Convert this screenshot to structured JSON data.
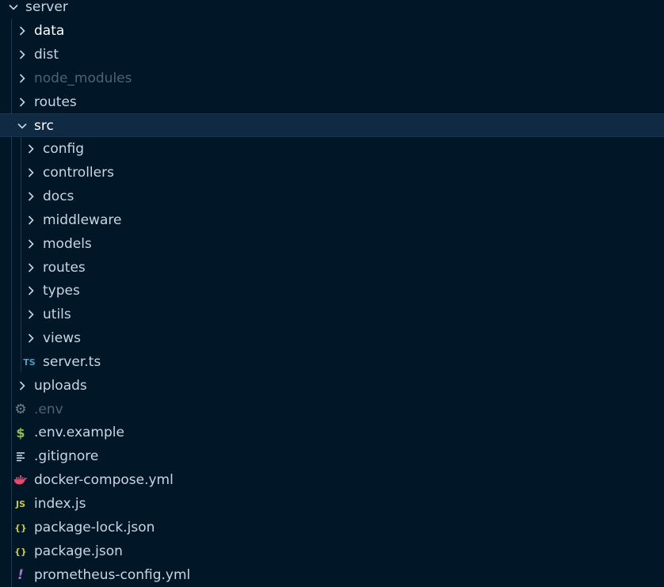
{
  "explorer": {
    "root": {
      "label": "server"
    },
    "items": [
      {
        "label": "data",
        "kind": "folder",
        "expanded": false,
        "depth": 0
      },
      {
        "label": "dist",
        "kind": "folder",
        "expanded": false,
        "depth": 0
      },
      {
        "label": "node_modules",
        "kind": "folder",
        "expanded": false,
        "depth": 0,
        "dimmed": true
      },
      {
        "label": "routes",
        "kind": "folder",
        "expanded": false,
        "depth": 0
      },
      {
        "label": "src",
        "kind": "folder",
        "expanded": true,
        "depth": 0,
        "selected": true
      },
      {
        "label": "config",
        "kind": "folder",
        "expanded": false,
        "depth": 1
      },
      {
        "label": "controllers",
        "kind": "folder",
        "expanded": false,
        "depth": 1
      },
      {
        "label": "docs",
        "kind": "folder",
        "expanded": false,
        "depth": 1
      },
      {
        "label": "middleware",
        "kind": "folder",
        "expanded": false,
        "depth": 1
      },
      {
        "label": "models",
        "kind": "folder",
        "expanded": false,
        "depth": 1
      },
      {
        "label": "routes",
        "kind": "folder",
        "expanded": false,
        "depth": 1
      },
      {
        "label": "types",
        "kind": "folder",
        "expanded": false,
        "depth": 1
      },
      {
        "label": "utils",
        "kind": "folder",
        "expanded": false,
        "depth": 1
      },
      {
        "label": "views",
        "kind": "folder",
        "expanded": false,
        "depth": 1
      },
      {
        "label": "server.ts",
        "kind": "file",
        "icon": "typescript-icon",
        "icon_text": "TS",
        "icon_color": "#519aba",
        "depth": 1
      },
      {
        "label": "uploads",
        "kind": "folder",
        "expanded": false,
        "depth": 0
      },
      {
        "label": ".env",
        "kind": "file",
        "icon": "gear-icon",
        "icon_text": "⚙",
        "icon_color": "#6d8086",
        "depth": 0,
        "dimmed": true
      },
      {
        "label": ".env.example",
        "kind": "file",
        "icon": "dollar-icon",
        "icon_text": "$",
        "icon_color": "#8dc149",
        "depth": 0
      },
      {
        "label": ".gitignore",
        "kind": "file",
        "icon": "lines-icon",
        "icon_text": "≡",
        "icon_color": "#c9d6e3",
        "depth": 0
      },
      {
        "label": "docker-compose.yml",
        "kind": "file",
        "icon": "docker-icon",
        "icon_text": "",
        "icon_color": "#e8496e",
        "depth": 0
      },
      {
        "label": "index.js",
        "kind": "file",
        "icon": "javascript-icon",
        "icon_text": "JS",
        "icon_color": "#cbcb41",
        "depth": 0
      },
      {
        "label": "package-lock.json",
        "kind": "file",
        "icon": "json-braces-icon",
        "icon_text": "{}",
        "icon_color": "#cbcb41",
        "depth": 0
      },
      {
        "label": "package.json",
        "kind": "file",
        "icon": "json-braces-icon",
        "icon_text": "{}",
        "icon_color": "#cbcb41",
        "depth": 0
      },
      {
        "label": "prometheus-config.yml",
        "kind": "file",
        "icon": "exclamation-icon",
        "icon_text": "!",
        "icon_color": "#a074c4",
        "depth": 0
      }
    ]
  },
  "colors": {
    "background": "#011627",
    "selection": "#0f2a42",
    "text": "#c9d6e3",
    "dimmed_text": "#4c6478",
    "scrollbar": "#0b2942"
  }
}
